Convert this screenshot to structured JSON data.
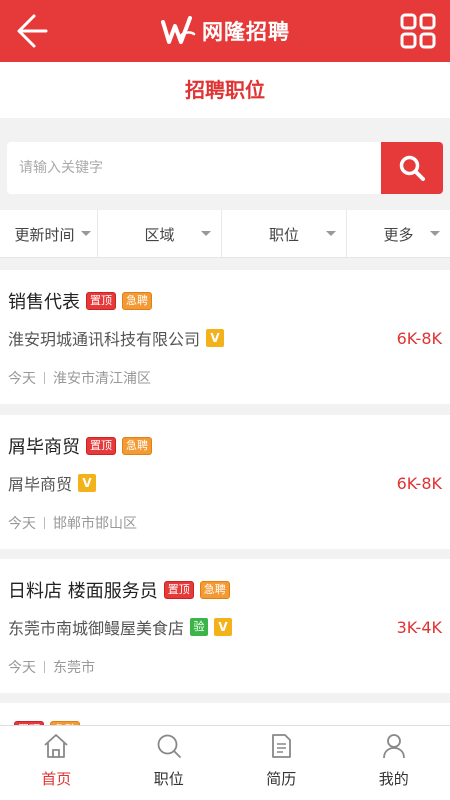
{
  "header": {
    "app_title": "网隆招聘",
    "page_title": "招聘职位",
    "brand_color": "#e63a3a"
  },
  "search": {
    "placeholder": "请输入关键字",
    "value": ""
  },
  "filters": [
    {
      "label": "更新时间"
    },
    {
      "label": "区域"
    },
    {
      "label": "职位"
    },
    {
      "label": "更多"
    }
  ],
  "jobs": [
    {
      "title": "销售代表",
      "badges": [
        "置顶",
        "急聘"
      ],
      "company": "淮安玥城通讯科技有限公司",
      "salary": "6K-8K",
      "date": "今天",
      "location": "淮安市清江浦区"
    },
    {
      "title": "屑毕商贸",
      "badges": [
        "置顶",
        "急聘"
      ],
      "company": "屑毕商贸",
      "salary": "6K-8K",
      "date": "今天",
      "location": "邯郸市邯山区"
    },
    {
      "title": "日料店 楼面服务员",
      "badges": [
        "置顶",
        "急聘"
      ],
      "company": "东莞市南城御鳗屋美食店",
      "company_verified_text": "验",
      "salary": "3K-4K",
      "date": "今天",
      "location": "东莞市"
    },
    {
      "title": "",
      "badges": [
        "置顶",
        "急聘"
      ]
    }
  ],
  "tabs": [
    {
      "label": "首页",
      "icon": "home-icon",
      "active": true
    },
    {
      "label": "职位",
      "icon": "search-icon",
      "active": false
    },
    {
      "label": "简历",
      "icon": "resume-icon",
      "active": false
    },
    {
      "label": "我的",
      "icon": "user-icon",
      "active": false
    }
  ],
  "colors": {
    "accent": "#e63a3a",
    "salary": "#e03333",
    "urgent_badge": "#f39a34",
    "verified_badge": "#f3b21a"
  }
}
